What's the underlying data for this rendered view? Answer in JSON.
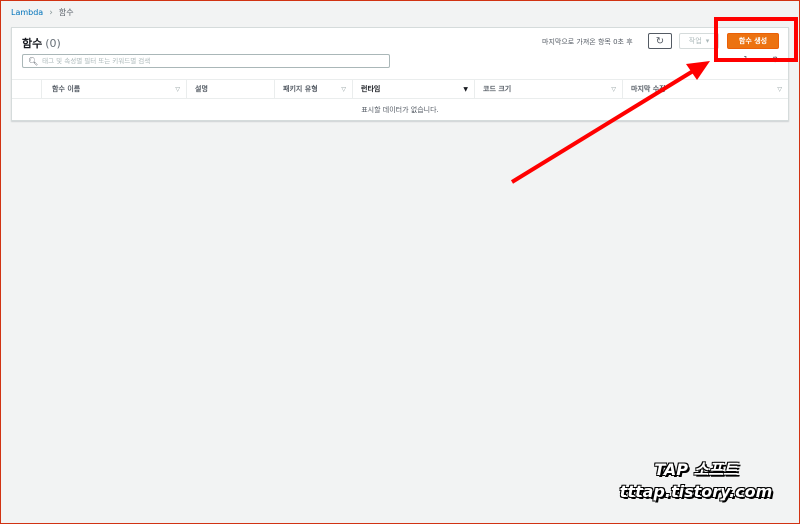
{
  "breadcrumb": {
    "root": "Lambda",
    "current": "함수"
  },
  "header": {
    "title": "함수",
    "count": "(0)",
    "last_fetched": "마지막으로 가져온 항목 0초 후",
    "refresh_icon": "refresh-icon",
    "actions_label": "작업",
    "create_label": "함수 생성"
  },
  "search": {
    "placeholder": "태그 및 속성별 필터 또는 키워드별 검색",
    "value": ""
  },
  "table": {
    "columns": [
      {
        "label": "함수 이름"
      },
      {
        "label": "설명"
      },
      {
        "label": "패키지 유형"
      },
      {
        "label": "런타임"
      },
      {
        "label": "코드 크기"
      },
      {
        "label": "마지막 수정"
      }
    ],
    "empty_text": "표시할 데이터가 없습니다."
  },
  "pager": {
    "prev": "‹",
    "page": "1",
    "next": "›",
    "settings_icon": "gear-icon"
  },
  "annotation": {
    "arrow_color": "#ff0000",
    "box_color": "#ff0000"
  },
  "watermark": {
    "line1": "TAP 소프트",
    "line2": "tttap.tistory.com"
  }
}
